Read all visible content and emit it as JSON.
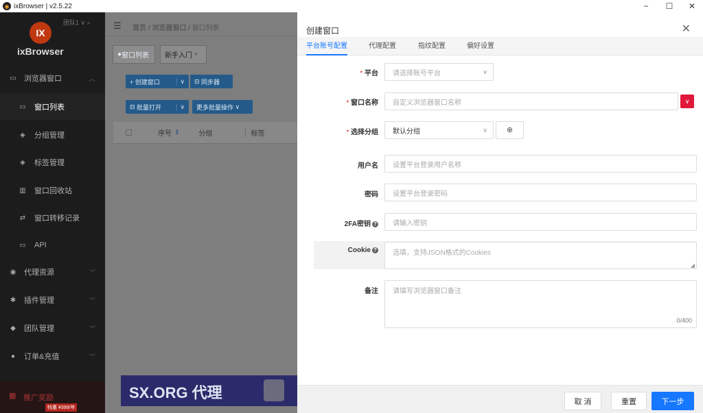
{
  "window": {
    "title": "ixBrowser | v2.5.22",
    "minimize": "−",
    "maximize": "☐",
    "close": "✕"
  },
  "sidebar": {
    "brand": "ixBrowser",
    "logo_text": "IX",
    "account": "团队1",
    "menu": [
      {
        "label": "浏览器窗口",
        "icon": "▭",
        "expanded": true
      },
      {
        "label": "窗口列表",
        "icon": "▭"
      },
      {
        "label": "分组管理",
        "icon": "◈"
      },
      {
        "label": "标签管理",
        "icon": "◈"
      },
      {
        "label": "窗口回收站",
        "icon": "▥"
      },
      {
        "label": "窗口转移记录",
        "icon": "⇄"
      },
      {
        "label": "API",
        "icon": "▭"
      },
      {
        "label": "代理资源",
        "icon": "◉"
      },
      {
        "label": "插件管理",
        "icon": "✱"
      },
      {
        "label": "团队管理",
        "icon": "◆"
      },
      {
        "label": "订单&充值",
        "icon": "●"
      }
    ],
    "promo": {
      "label": "推广奖励",
      "price": "特惠 ¥399/年"
    }
  },
  "main": {
    "breadcrumb": [
      "首页",
      "浏览器窗口",
      "窗口列表"
    ],
    "tabs": [
      "窗口列表",
      "新手入门"
    ],
    "buttons": {
      "create": "+ 创建窗口",
      "sync": "同步器",
      "batch_open": "批量打开",
      "more_batch": "更多批量操作"
    },
    "table_headers": [
      "序号",
      "分组",
      "标签"
    ],
    "banner": "SX.ORG 代理"
  },
  "drawer": {
    "title": "创建窗口",
    "tabs": [
      "平台账号配置",
      "代理配置",
      "指纹配置",
      "偏好设置"
    ],
    "fields": {
      "platform": {
        "label": "平台",
        "placeholder": "请选择账号平台"
      },
      "name": {
        "label": "窗口名称",
        "placeholder": "自定义浏览器窗口名称"
      },
      "group": {
        "label": "选择分组",
        "value": "默认分组"
      },
      "username": {
        "label": "用户名",
        "placeholder": "设置平台登录用户名称"
      },
      "password": {
        "label": "密码",
        "placeholder": "设置平台登录密码"
      },
      "twofa": {
        "label": "2FA密钥",
        "placeholder": "请输入密钥"
      },
      "cookie": {
        "label": "Cookie",
        "placeholder": "选填，支持JSON格式的Cookies"
      },
      "remark": {
        "label": "备注",
        "placeholder": "请填写浏览器窗口备注",
        "counter": "0/400"
      }
    },
    "footer": {
      "cancel": "取 消",
      "reset": "重置",
      "next": "下一步"
    },
    "colors": {
      "accent": "#1677ff",
      "danger": "#e0193a"
    }
  }
}
